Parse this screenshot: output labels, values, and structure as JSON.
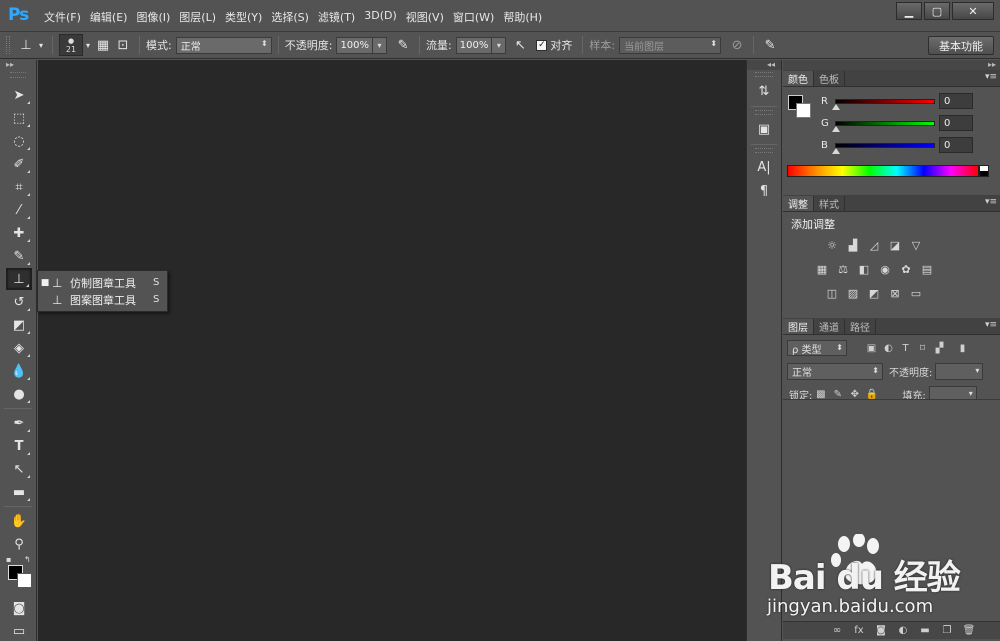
{
  "app": {
    "logo": "Ps"
  },
  "menu": [
    "文件(F)",
    "编辑(E)",
    "图像(I)",
    "图层(L)",
    "类型(Y)",
    "选择(S)",
    "滤镜(T)",
    "3D(D)",
    "视图(V)",
    "窗口(W)",
    "帮助(H)"
  ],
  "window_controls": {
    "minimize": "▁",
    "maximize": "▢",
    "close": "✕"
  },
  "options": {
    "brush_size": "21",
    "mode_label": "模式:",
    "mode_value": "正常",
    "opacity_label": "不透明度:",
    "opacity_value": "100%",
    "flow_label": "流量:",
    "flow_value": "100%",
    "align_label": "对齐",
    "sample_label": "样本:",
    "sample_value": "当前图层",
    "workspace": "基本功能"
  },
  "flyout": [
    {
      "label": "仿制图章工具",
      "shortcut": "S",
      "selected": true
    },
    {
      "label": "图案图章工具",
      "shortcut": "S",
      "selected": false
    }
  ],
  "color_panel": {
    "tabs": [
      "颜色",
      "色板"
    ],
    "channels": [
      {
        "label": "R",
        "value": "0",
        "color": "#ff0000"
      },
      {
        "label": "G",
        "value": "0",
        "color": "#00ff00"
      },
      {
        "label": "B",
        "value": "0",
        "color": "#0000ff"
      }
    ]
  },
  "adjustments_panel": {
    "tabs": [
      "调整",
      "样式"
    ],
    "title": "添加调整"
  },
  "layers_panel": {
    "tabs": [
      "图层",
      "通道",
      "路径"
    ],
    "filter_label": "ρ 类型",
    "blend_mode": "正常",
    "opacity_label": "不透明度:",
    "lock_label": "锁定:",
    "fill_label": "填充:"
  },
  "watermark": {
    "logo": "Bai du 经验",
    "url": "jingyan.baidu.com"
  },
  "colors": {
    "canvas": "#282828",
    "ui": "#535353",
    "accent": "#31a8ff"
  }
}
